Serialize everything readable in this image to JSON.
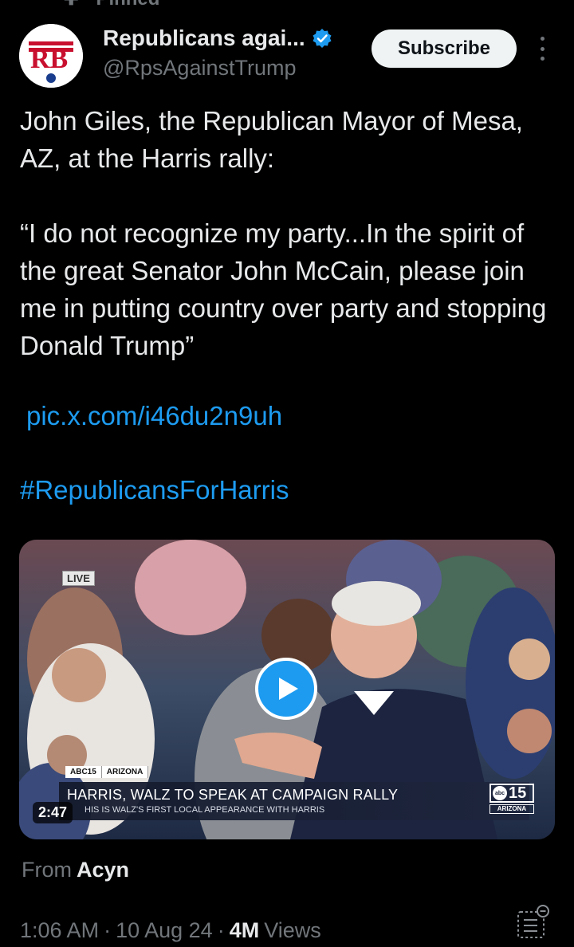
{
  "pinned": {
    "label": "Pinned",
    "icon": "pin-icon"
  },
  "account": {
    "display_name": "Republicans agai...",
    "handle": "@RpsAgainstTrump",
    "avatar_text": "RB",
    "verified": true,
    "subscribe_label": "Subscribe"
  },
  "tweet": {
    "paragraph1": "John Giles, the Republican Mayor of Mesa, AZ, at the Harris rally:",
    "paragraph2": "“I do not recognize my party...In the spirit of the great Senator John McCain, please join me in putting country over party and stopping Donald Trump”",
    "link": "pic.x.com/i46du2n9uh",
    "hashtag": "#RepublicansForHarris"
  },
  "video": {
    "live_label": "LIVE",
    "tag_station": "ABC15",
    "tag_region": "ARIZONA",
    "headline": "HARRIS, WALZ TO SPEAK AT CAMPAIGN RALLY",
    "subline": "HIS IS WALZ'S FIRST LOCAL APPEARANCE WITH HARRIS",
    "logo_abc": "abc",
    "logo_number": "15",
    "logo_state": "ARIZONA",
    "duration": "2:47",
    "play_icon": "play-icon"
  },
  "source": {
    "prefix": "From",
    "name": "Acyn"
  },
  "meta": {
    "time": "1:06 AM",
    "date": "10 Aug 24",
    "views_count": "4M",
    "views_label": "Views",
    "separator": "·"
  },
  "colors": {
    "background": "#000000",
    "text": "#e7e9ea",
    "secondary": "#71767b",
    "link": "#1d9bf0",
    "verified": "#1d9bf0"
  }
}
